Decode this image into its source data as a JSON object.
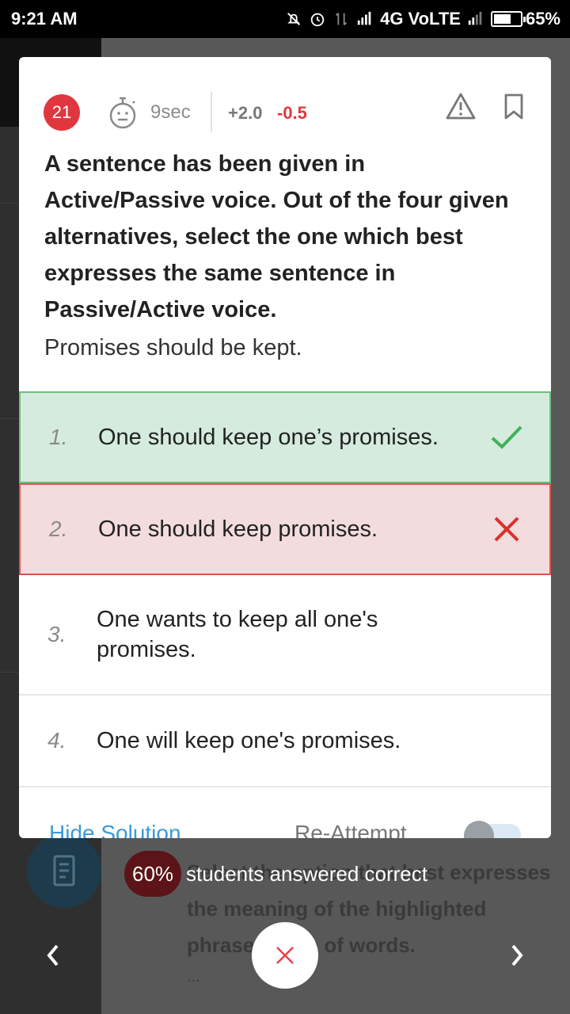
{
  "status_bar": {
    "time": "9:21 AM",
    "network": "4G VoLTE",
    "battery_percent": "65%",
    "battery_level": 0.65,
    "icons": [
      "mute-bell-icon",
      "alarm-icon",
      "data-arrows-icon",
      "signal-icon",
      "signal-icon-2",
      "battery-icon"
    ]
  },
  "question_meta": {
    "number": "21",
    "time_taken": "9sec",
    "marks_positive": "+2.0",
    "marks_negative": "-0.5",
    "icons": [
      "stopwatch-face-icon",
      "report-warning-icon",
      "bookmark-icon"
    ]
  },
  "question": {
    "text": "A sentence has been given in Active/Passive voice. Out of the four given alternatives, select the one which best expresses the same sentence in Passive/Active voice.",
    "sentence": "Promises should be kept."
  },
  "options": [
    {
      "num": "1.",
      "text": "One should keep one’s promises.",
      "state": "correct"
    },
    {
      "num": "2.",
      "text": "One should keep promises.",
      "state": "wrong"
    },
    {
      "num": "3.",
      "text": "One wants to keep all one's promises.",
      "state": "none"
    },
    {
      "num": "4.",
      "text": "One will keep one's promises.",
      "state": "none"
    }
  ],
  "footer": {
    "hide_solution": "Hide Solution",
    "reattempt": "Re-Attempt"
  },
  "toast": {
    "percent": "60%",
    "text": "students answered correct"
  },
  "background_page": {
    "next_question": "Select the option that best expresses the meaning of the highlighted phrase/group of words.",
    "ellipsis": "..."
  },
  "colors": {
    "correct_bg": "#d4ebdd",
    "correct_border": "#6cc07e",
    "wrong_bg": "#f2dcdd",
    "wrong_border": "#d9534f",
    "accent_red": "#e0373f",
    "link_blue": "#3a9bd9"
  }
}
